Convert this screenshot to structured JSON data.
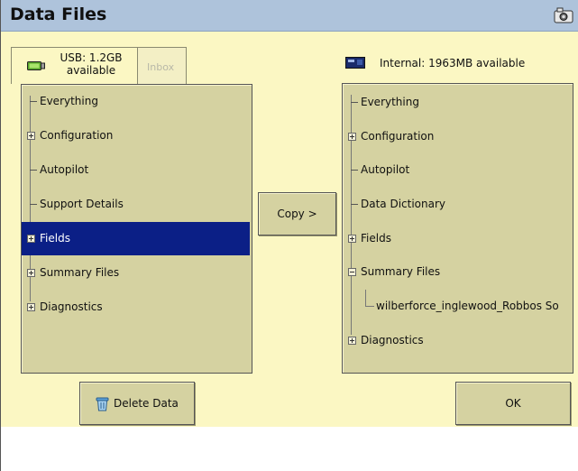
{
  "window": {
    "title": "Data Files"
  },
  "source": {
    "tabs": [
      {
        "label": "USB: 1.2GB available",
        "line1": "USB: 1.2GB",
        "line2": "available"
      },
      {
        "label": "Inbox"
      }
    ],
    "items": [
      "Everything",
      "Configuration",
      "Autopilot",
      "Support Details",
      "Fields",
      "Summary Files",
      "Diagnostics"
    ],
    "selected": "Fields"
  },
  "dest": {
    "label": "Internal: 1963MB available",
    "items": [
      "Everything",
      "Configuration",
      "Autopilot",
      "Data Dictionary",
      "Fields",
      "Summary Files",
      "wilberforce_inglewood_Robbos So",
      "Diagnostics"
    ]
  },
  "buttons": {
    "copy": "Copy >",
    "delete": "Delete Data",
    "ok": "OK"
  },
  "icons": {
    "camera": "camera-icon",
    "usb": "usb-drive-icon",
    "internal": "internal-storage-icon",
    "trash": "trash-icon"
  },
  "colors": {
    "title_bar": "#aec3db",
    "background": "#fbf7c3",
    "panel": "#d5d2a1",
    "selection": "#0b1f86"
  }
}
